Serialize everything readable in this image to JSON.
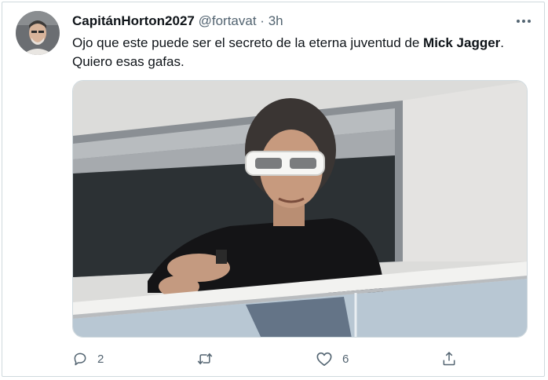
{
  "tweet": {
    "display_name": "CapitánHorton2027",
    "handle": "@fortavat",
    "separator": "·",
    "time": "3h",
    "text_before": "Ojo que este puede ser el secreto de la eterna juventud de ",
    "text_bold": "Mick Jagger",
    "text_after": ". Quiero esas gafas.",
    "more_icon": "more-horizontal-icon"
  },
  "actions": {
    "reply": {
      "icon": "reply-icon",
      "count": "2"
    },
    "retweet": {
      "icon": "retweet-icon",
      "count": ""
    },
    "like": {
      "icon": "heart-icon",
      "count": "6"
    },
    "share": {
      "icon": "share-icon"
    }
  },
  "colors": {
    "text": "#0f1419",
    "secondary": "#536471",
    "border": "#cfd9de"
  }
}
